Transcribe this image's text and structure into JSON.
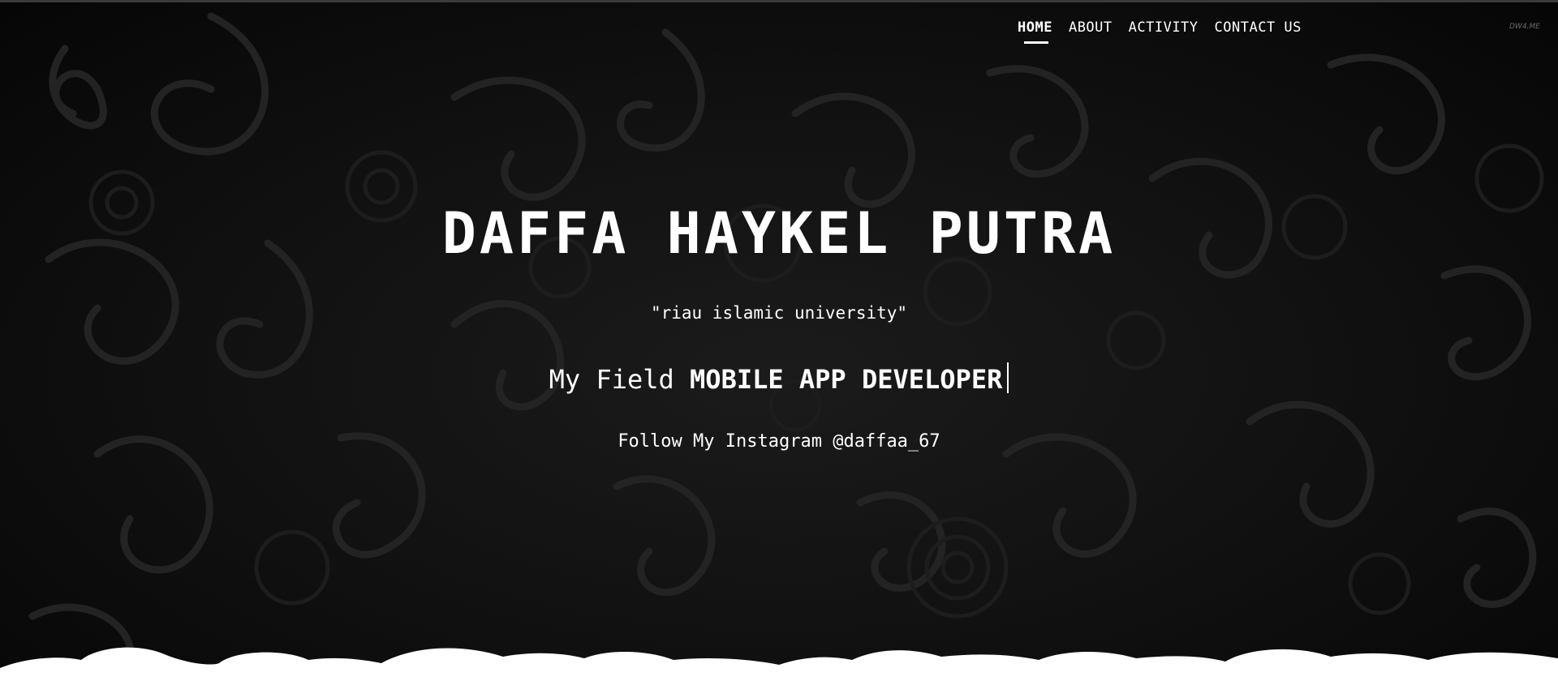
{
  "nav": {
    "items": [
      {
        "label": "HOME",
        "active": true
      },
      {
        "label": "ABOUT",
        "active": false
      },
      {
        "label": "ACTIVITY",
        "active": false
      },
      {
        "label": "CONTACT US",
        "active": false
      }
    ]
  },
  "watermark": "DW4.ME",
  "hero": {
    "name": "DAFFA HAYKEL PUTRA",
    "quote": "\"riau islamic university\"",
    "field_prefix": "My Field",
    "field_value": "MOBILE APP DEVELOPER",
    "instagram": "Follow My Instagram @daffaa_67"
  },
  "colors": {
    "background": "#0c0c0c",
    "text": "#ffffff",
    "pattern": "#262626",
    "footer_clouds": "#ffffff"
  }
}
